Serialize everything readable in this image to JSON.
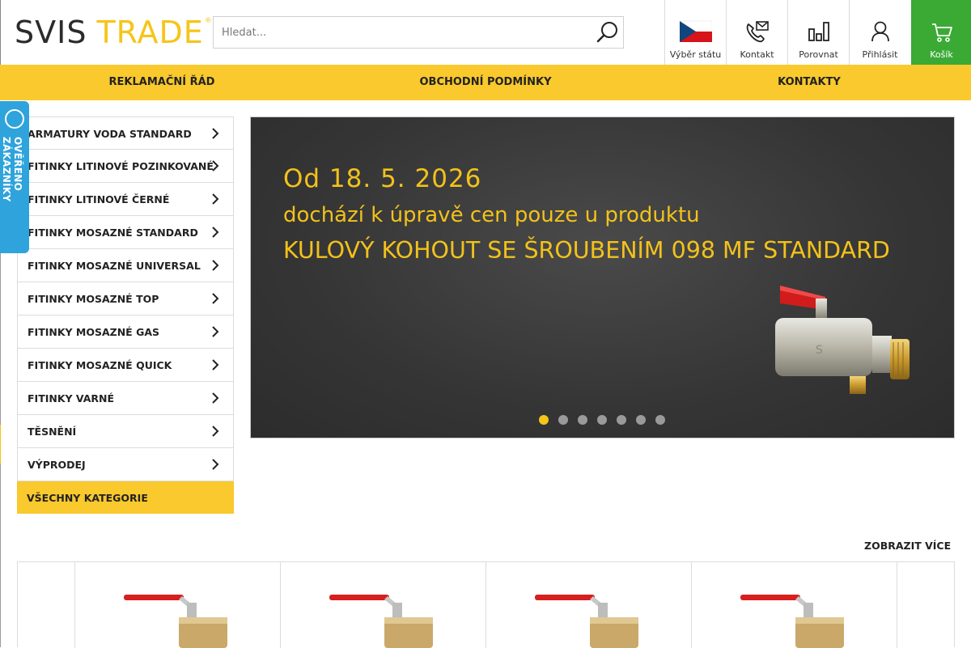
{
  "logo": {
    "part1": "SVIS",
    "part2": "TRADE",
    "reg": "®"
  },
  "search": {
    "placeholder": "Hledat..."
  },
  "header_buttons": [
    {
      "label": "Výběr státu",
      "icon": "czech-flag-icon"
    },
    {
      "label": "Kontakt",
      "icon": "phone-mail-icon"
    },
    {
      "label": "Porovnat",
      "icon": "compare-bars-icon"
    },
    {
      "label": "Přihlásit",
      "icon": "user-icon"
    },
    {
      "label": "Košík",
      "icon": "cart-icon"
    }
  ],
  "nav": [
    "REKLAMAČNÍ ŘÁD",
    "OBCHODNÍ PODMÍNKY",
    "KONTAKTY"
  ],
  "verified_badge": {
    "text": "OVĚŘENO ZÁKAZNÍKY"
  },
  "categories": [
    "ARMATURY VODA STANDARD",
    "FITINKY LITINOVÉ POZINKOVANÉ",
    "FITINKY LITINOVÉ ČERNÉ",
    "FITINKY MOSAZNÉ STANDARD",
    "FITINKY MOSAZNÉ UNIVERSAL",
    "FITINKY MOSAZNÉ TOP",
    "FITINKY MOSAZNÉ GAS",
    "FITINKY MOSAZNÉ QUICK",
    "FITINKY VARNÉ",
    "TĚSNĚNÍ",
    "VÝPRODEJ"
  ],
  "all_categories": "VŠECHNY KATEGORIE",
  "banner": {
    "line1": "Od 18. 5. 2026",
    "line2": "dochází k úpravě cen pouze u produktu",
    "line3": "KULOVÝ KOHOUT SE ŠROUBENÍM 098 MF STANDARD",
    "slide_count": 7,
    "active_slide": 1
  },
  "show_more": "ZOBRAZIT VÍCE",
  "colors": {
    "accent": "#f9c92d",
    "cart": "#3aaa35",
    "badge": "#2ea3dc",
    "banner_text": "#f2c21b"
  }
}
